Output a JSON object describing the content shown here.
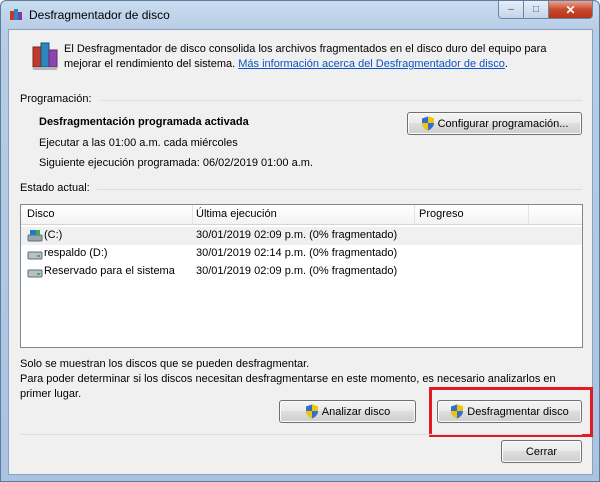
{
  "window": {
    "title": "Desfragmentador de disco",
    "minimize_glyph": "–",
    "maximize_glyph": "□",
    "close_glyph": "✕"
  },
  "intro": {
    "text": "El Desfragmentador de disco consolida los archivos fragmentados en el disco duro del equipo para mejorar el rendimiento del sistema. ",
    "link": "Más información acerca del Desfragmentador de disco",
    "end": "."
  },
  "schedule": {
    "label": "Programación:",
    "status": "Desfragmentación programada activada",
    "run_at": "Ejecutar a las 01:00 a.m. cada miércoles",
    "next_run": "Siguiente ejecución programada: 06/02/2019 01:00 a.m.",
    "configure_button": "Configurar programación..."
  },
  "status": {
    "label": "Estado actual:",
    "columns": [
      "Disco",
      "Última ejecución",
      "Progreso"
    ],
    "rows": [
      {
        "disk": "(C:)",
        "last_run": "30/01/2019 02:09 p.m. (0% fragmentado)",
        "progress": "",
        "icon": "system-drive-icon"
      },
      {
        "disk": "respaldo  (D:)",
        "last_run": "30/01/2019 02:14 p.m. (0% fragmentado)",
        "progress": "",
        "icon": "hard-drive-icon"
      },
      {
        "disk": "Reservado para el sistema",
        "last_run": "30/01/2019 02:09 p.m. (0% fragmentado)",
        "progress": "",
        "icon": "hard-drive-icon"
      }
    ]
  },
  "notes": {
    "line1": "Solo se muestran los discos que se pueden desfragmentar.",
    "line2": "Para poder determinar si los discos necesitan desfragmentarse en este momento, es necesario analizarlos en primer lugar."
  },
  "buttons": {
    "analyze": "Analizar disco",
    "defragment": "Desfragmentar disco",
    "close": "Cerrar"
  },
  "colors": {
    "link": "#0b54c2",
    "highlight": "#e01b24",
    "window_frame": "#a9c3e1"
  }
}
